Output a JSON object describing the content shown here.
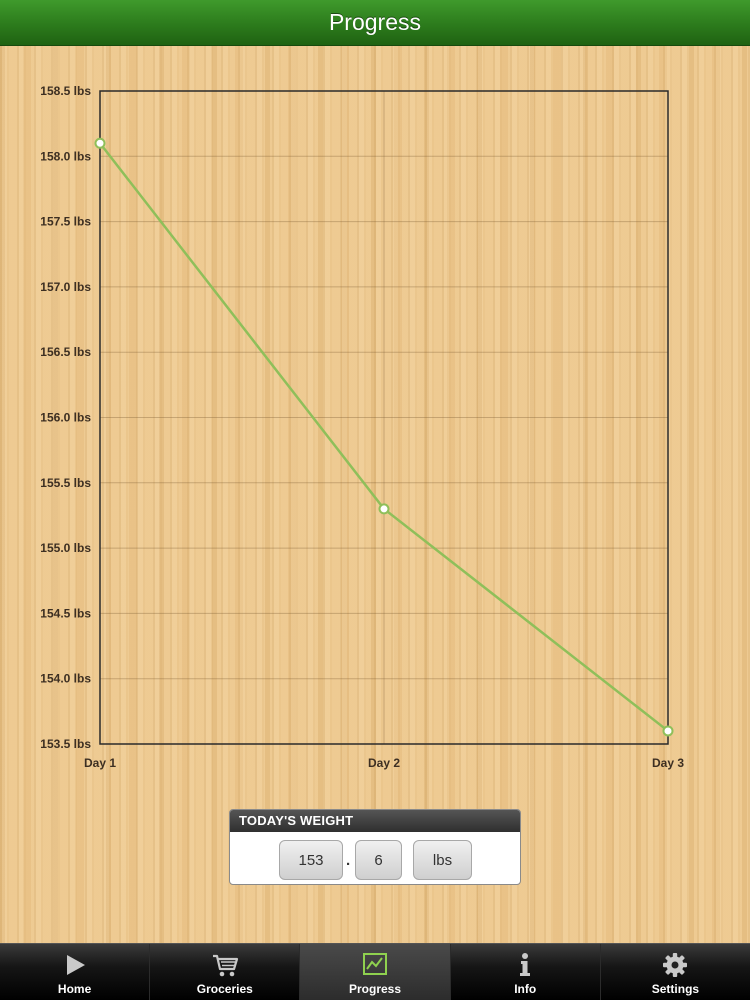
{
  "header": {
    "title": "Progress"
  },
  "chart_data": {
    "type": "line",
    "categories": [
      "Day 1",
      "Day 2",
      "Day 3"
    ],
    "series": [
      {
        "values": [
          158.1,
          155.3,
          153.6
        ]
      }
    ],
    "ylim": [
      153.5,
      158.5
    ],
    "ytick_values": [
      153.5,
      154.0,
      154.5,
      155.0,
      155.5,
      156.0,
      156.5,
      157.0,
      157.5,
      158.0,
      158.5
    ],
    "ytick_labels": [
      "153.5 lbs",
      "154.0 lbs",
      "154.5 lbs",
      "155.0 lbs",
      "155.5 lbs",
      "156.0 lbs",
      "156.5 lbs",
      "157.0 lbs",
      "157.5 lbs",
      "158.0 lbs",
      "158.5 lbs"
    ],
    "grid": true,
    "line_color": "#8fbf5a"
  },
  "weight_panel": {
    "header": "TODAY'S WEIGHT",
    "whole": "153",
    "separator": ".",
    "decimal": "6",
    "unit": "lbs"
  },
  "tabs": [
    {
      "label": "Home",
      "icon": "play-icon"
    },
    {
      "label": "Groceries",
      "icon": "cart-icon"
    },
    {
      "label": "Progress",
      "icon": "chart-icon",
      "active": true
    },
    {
      "label": "Info",
      "icon": "info-icon"
    },
    {
      "label": "Settings",
      "icon": "gear-icon"
    }
  ]
}
